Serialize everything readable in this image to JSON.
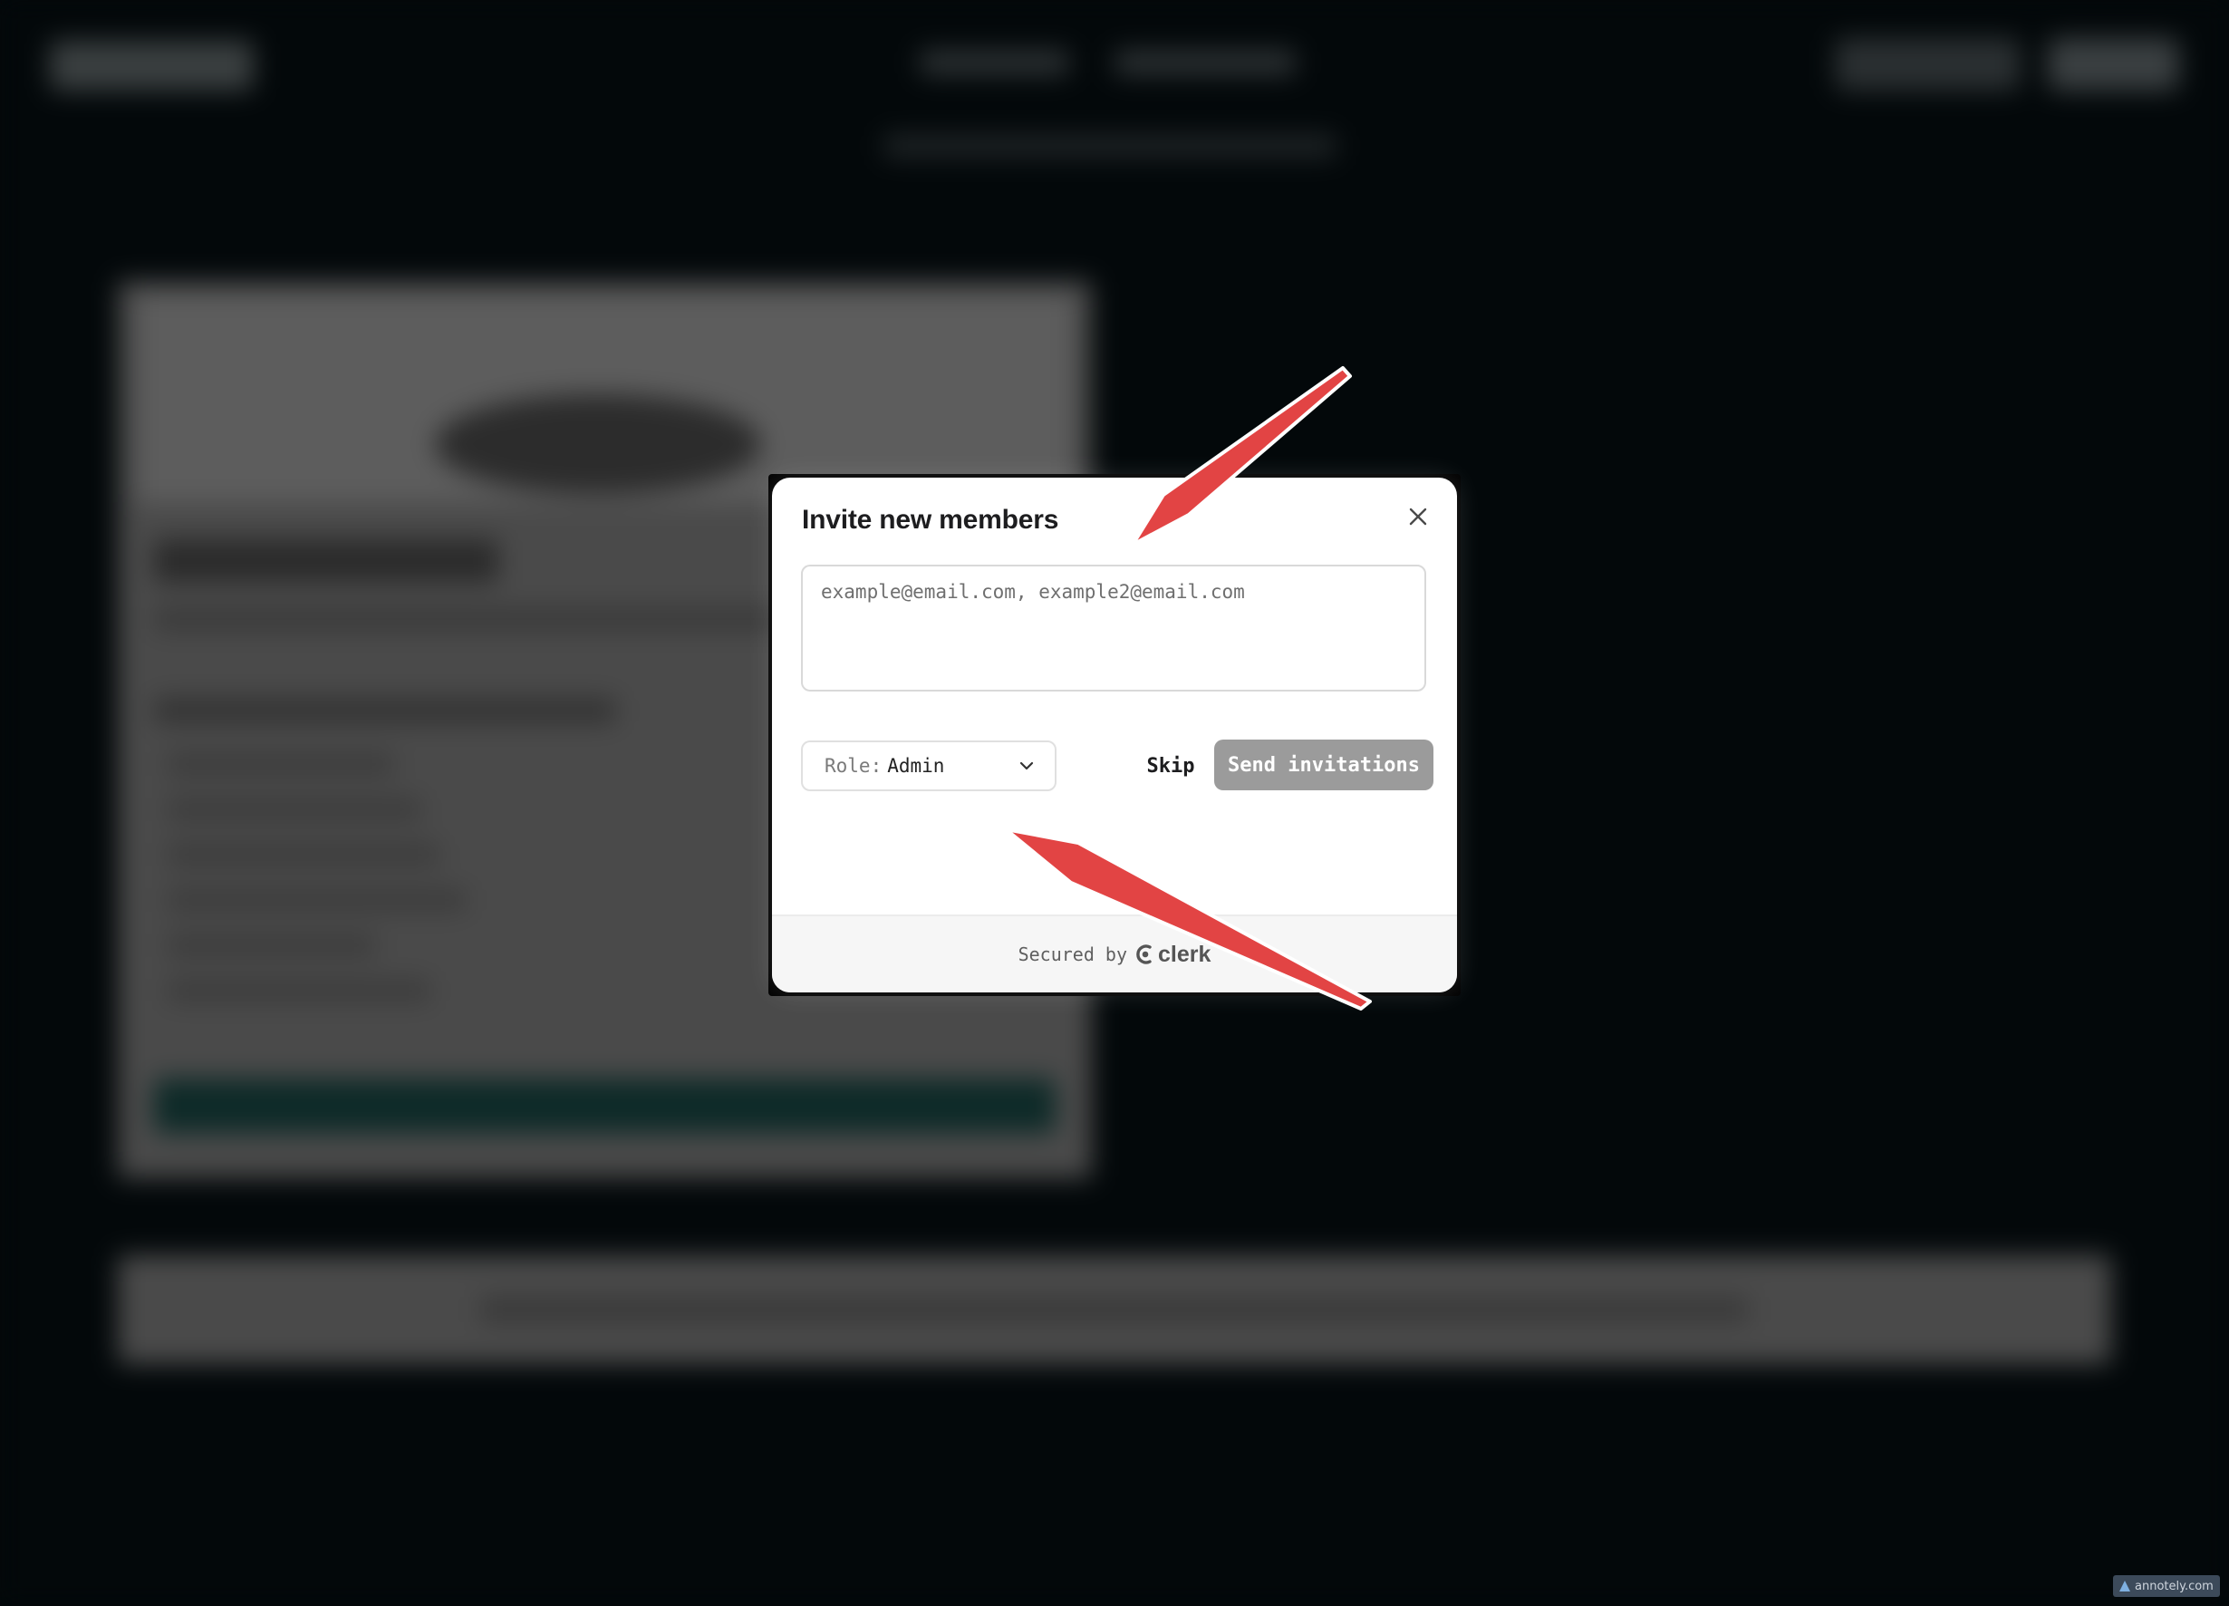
{
  "dialog": {
    "title": "Invite new members",
    "email_placeholder": "example@email.com, example2@email.com",
    "email_value": "",
    "role": {
      "prefix": "Role:",
      "value": "Admin"
    },
    "skip_label": "Skip",
    "send_label": "Send invitations",
    "send_disabled": true
  },
  "footer": {
    "secured_by": "Secured by",
    "brand": "clerk"
  },
  "icons": {
    "close": "close-icon",
    "chevron": "chevron-down-icon",
    "brand": "clerk-logo-icon"
  },
  "annotations": {
    "arrow_color": "#e24444",
    "arrows": 2
  },
  "watermark": "annotely.com",
  "colors": {
    "backdrop": "#03080a",
    "send_button_disabled": "#9b9b9b",
    "footer_bg": "#f6f6f6"
  }
}
